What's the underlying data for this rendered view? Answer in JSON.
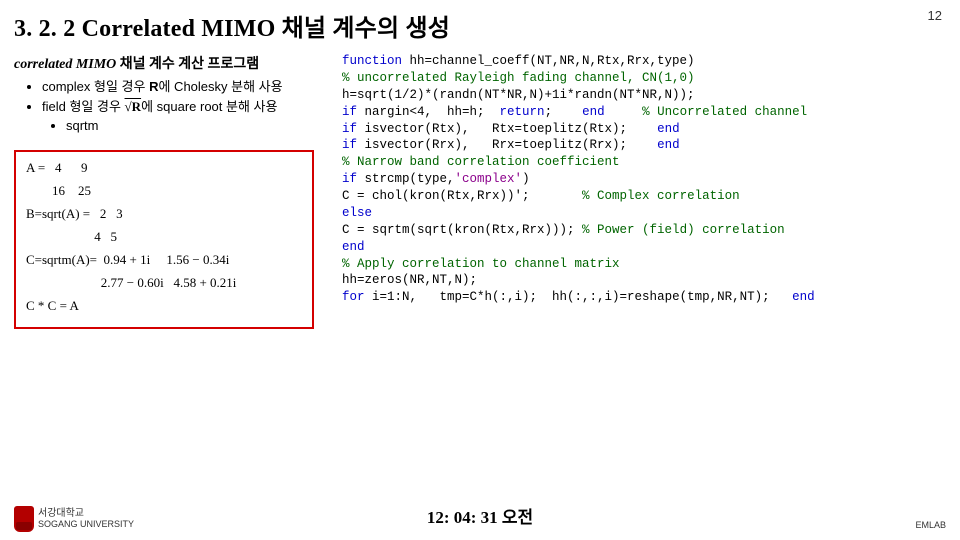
{
  "header": {
    "section_num": "3. 2. 2",
    "title_en": "Correlated MIMO",
    "title_kr": "채널 계수의 생성",
    "page_num": "12"
  },
  "left": {
    "subheading_pre": "correlated MIMO",
    "subheading_post": " 채널 계수 계산 프로그램",
    "b1_pre": "complex 형일 경우 ",
    "b1_bold": "R",
    "b1_post": "에 Cholesky 분해 사용",
    "b2_pre": "field 형일 경우 ",
    "b2_sqrt": "√R",
    "b2_post": "에 square root 분해 사용",
    "b2_sub": "sqrtm",
    "math": {
      "l1": "A =   4      9",
      "l1b": "        16    25",
      "l2": "B=sqrt(A) =   2   3",
      "l2b": "                     4   5",
      "l3": "C=sqrtm(A)=  0.94 + 1i     1.56 − 0.34i",
      "l3b": "                       2.77 − 0.60i   4.58 + 0.21i",
      "l4": "C * C = A"
    }
  },
  "code": {
    "c01a": "function",
    "c01b": " hh=channel_coeff(NT,NR,N,Rtx,Rrx,type)",
    "c02": "% uncorrelated Rayleigh fading channel, CN(1,0)",
    "c03": "h=sqrt(1/2)*(randn(NT*NR,N)+1i*randn(NT*NR,N));",
    "c04a": "if",
    "c04b": " nargin<4,  hh=h;  ",
    "c04c": "return",
    "c04d": ";    ",
    "c04e": "end",
    "c04f": "     ",
    "c04g": "% Uncorrelated channel",
    "c05a": "if",
    "c05b": " isvector(Rtx),   Rtx=toeplitz(Rtx);    ",
    "c05c": "end",
    "c06a": "if",
    "c06b": " isvector(Rrx),   Rrx=toeplitz(Rrx);    ",
    "c06c": "end",
    "c07": "% Narrow band correlation coefficient",
    "c08a": "if",
    "c08b": " strcmp(type,",
    "c08c": "'complex'",
    "c08d": ")",
    "c09a": "C = chol(kron(Rtx,Rrx))';       ",
    "c09b": "% Complex correlation",
    "c10": "else",
    "c11a": "C = sqrtm(sqrt(kron(Rtx,Rrx))); ",
    "c11b": "% Power (field) correlation",
    "c12": "end",
    "c13": "% Apply correlation to channel matrix",
    "c14": "hh=zeros(NR,NT,N);",
    "c15a": "for",
    "c15b": " i=1:N,   tmp=C*h(:,i);  hh(:,:,i)=reshape(tmp,NR,NT);   ",
    "c15c": "end"
  },
  "footer": {
    "uni_kr": "서강대학교",
    "uni_en": "SOGANG UNIVERSITY",
    "time": "12: 04: 31 오전",
    "lab": "EMLAB"
  }
}
